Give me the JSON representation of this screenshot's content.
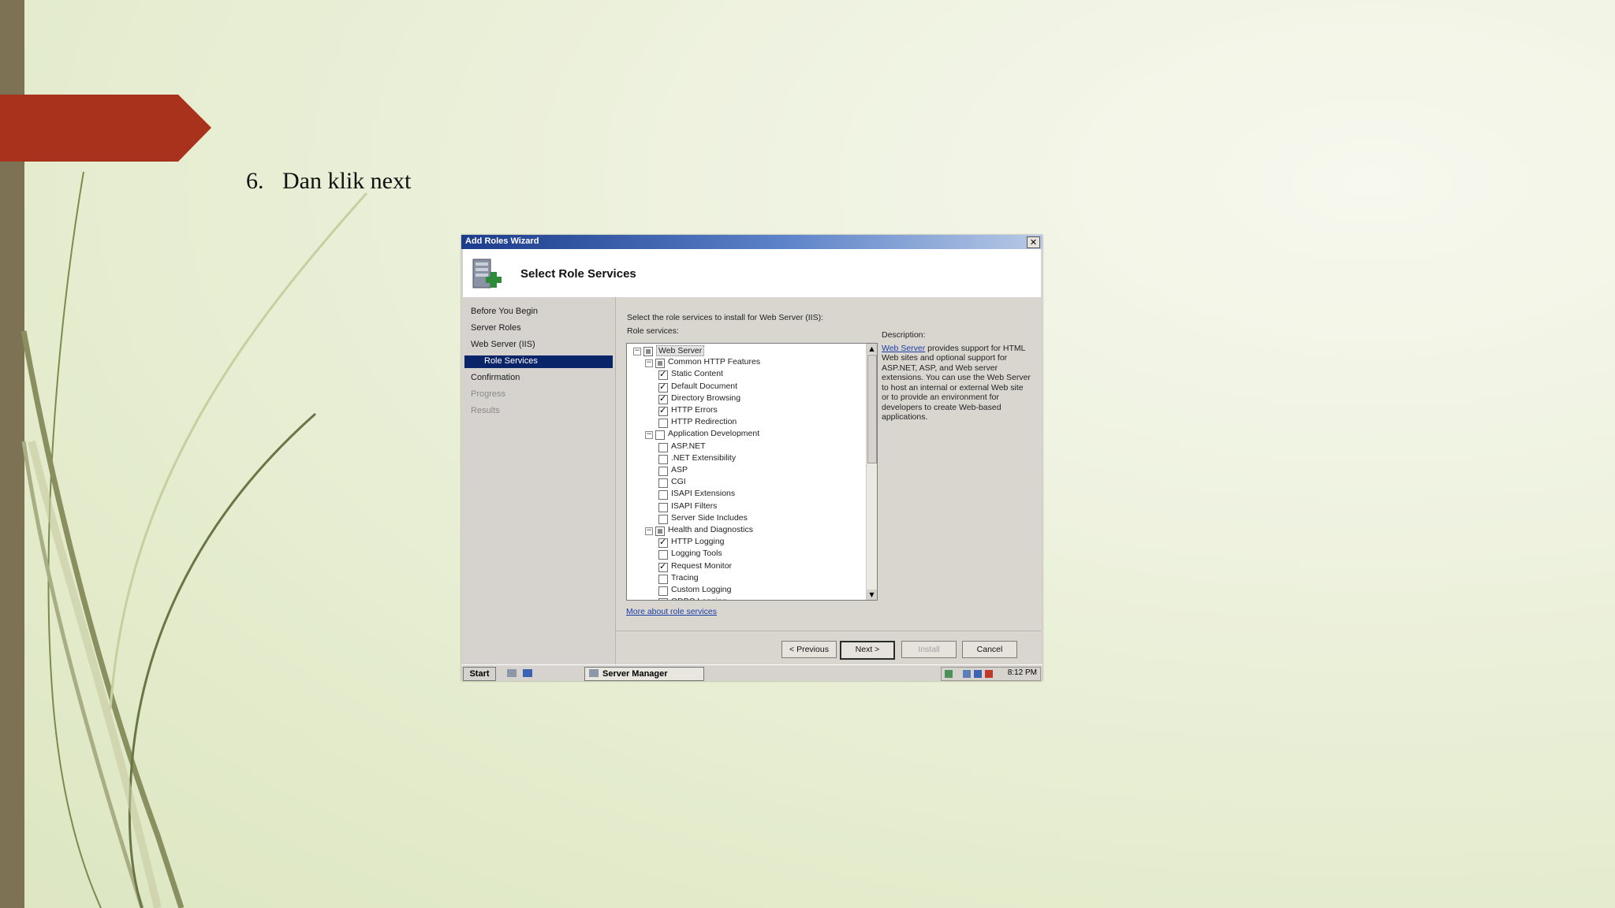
{
  "slide": {
    "step_number": "6.",
    "step_text": "Dan klik next"
  },
  "window": {
    "title": "Add Roles Wizard",
    "close_label": "✕",
    "header_title": "Select Role Services"
  },
  "nav": {
    "items": [
      "Before You Begin",
      "Server Roles",
      "Web Server (IIS)",
      "Role Services",
      "Confirmation",
      "Progress",
      "Results"
    ]
  },
  "content": {
    "instruction": "Select the role services to install for Web Server (IIS):",
    "list_label": "Role services:",
    "description_label": "Description:",
    "description_link": "Web Server",
    "description_text": " provides support for HTML Web sites and optional support for ASP.NET, ASP, and Web server extensions. You can use the Web Server to host an internal or external Web site or to provide an environment for developers to create Web-based applications.",
    "more_link": "More about role services"
  },
  "tree": {
    "items": [
      {
        "label": "Web Server",
        "level": 0,
        "state": "partial",
        "expander": "−"
      },
      {
        "label": "Common HTTP Features",
        "level": 1,
        "state": "partial",
        "expander": "−"
      },
      {
        "label": "Static Content",
        "level": 2,
        "state": "checked"
      },
      {
        "label": "Default Document",
        "level": 2,
        "state": "checked"
      },
      {
        "label": "Directory Browsing",
        "level": 2,
        "state": "checked"
      },
      {
        "label": "HTTP Errors",
        "level": 2,
        "state": "checked"
      },
      {
        "label": "HTTP Redirection",
        "level": 2,
        "state": "unchecked"
      },
      {
        "label": "Application Development",
        "level": 1,
        "state": "unchecked",
        "expander": "−"
      },
      {
        "label": "ASP.NET",
        "level": 2,
        "state": "unchecked"
      },
      {
        "label": ".NET Extensibility",
        "level": 2,
        "state": "unchecked"
      },
      {
        "label": "ASP",
        "level": 2,
        "state": "unchecked"
      },
      {
        "label": "CGI",
        "level": 2,
        "state": "unchecked"
      },
      {
        "label": "ISAPI Extensions",
        "level": 2,
        "state": "unchecked"
      },
      {
        "label": "ISAPI Filters",
        "level": 2,
        "state": "unchecked"
      },
      {
        "label": "Server Side Includes",
        "level": 2,
        "state": "unchecked"
      },
      {
        "label": "Health and Diagnostics",
        "level": 1,
        "state": "partial",
        "expander": "−"
      },
      {
        "label": "HTTP Logging",
        "level": 2,
        "state": "checked"
      },
      {
        "label": "Logging Tools",
        "level": 2,
        "state": "unchecked"
      },
      {
        "label": "Request Monitor",
        "level": 2,
        "state": "checked"
      },
      {
        "label": "Tracing",
        "level": 2,
        "state": "unchecked"
      },
      {
        "label": "Custom Logging",
        "level": 2,
        "state": "unchecked"
      },
      {
        "label": "ODBC Logging",
        "level": 2,
        "state": "unchecked"
      }
    ]
  },
  "buttons": {
    "previous": "< Previous",
    "next": "Next >",
    "install": "Install",
    "cancel": "Cancel"
  },
  "taskbar": {
    "start": "Start",
    "app": "Server Manager",
    "clock": "8:12 PM"
  },
  "colors": {
    "accent_tag": "#a8321c",
    "side_bar": "#7d7254",
    "selection": "#0a246a"
  }
}
